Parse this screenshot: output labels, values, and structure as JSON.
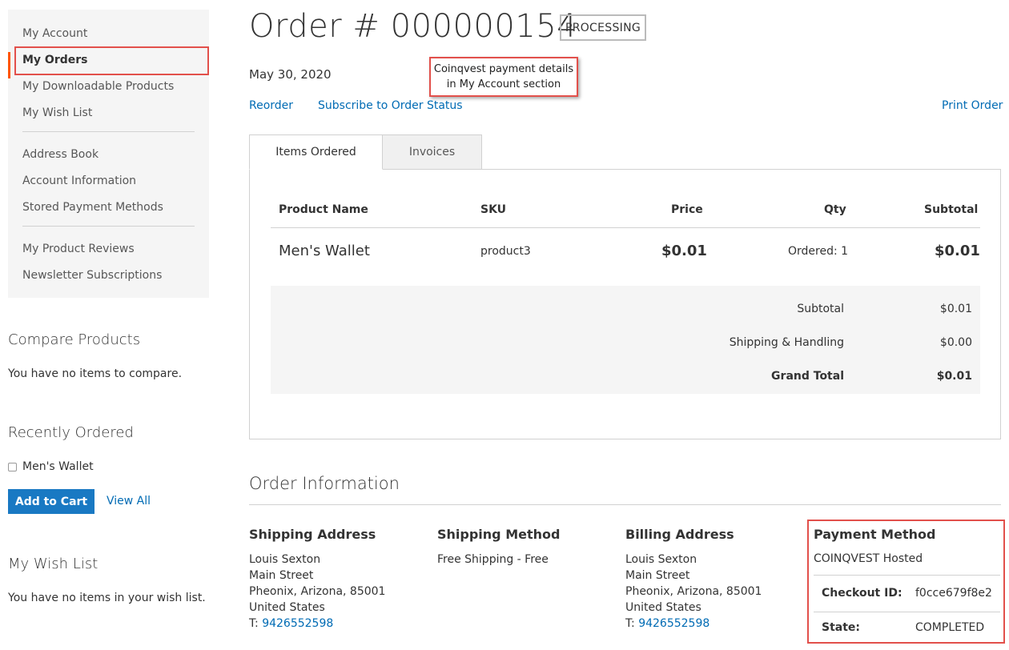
{
  "sidebar": {
    "items": [
      {
        "label": "My Account"
      },
      {
        "label": "My Orders"
      },
      {
        "label": "My Downloadable Products"
      },
      {
        "label": "My Wish List"
      },
      {
        "label": "Address Book"
      },
      {
        "label": "Account Information"
      },
      {
        "label": "Stored Payment Methods"
      },
      {
        "label": "My Product Reviews"
      },
      {
        "label": "Newsletter Subscriptions"
      }
    ]
  },
  "compare": {
    "title": "Compare Products",
    "empty": "You have no items to compare."
  },
  "recent": {
    "title": "Recently Ordered",
    "item": "Men's Wallet",
    "add_to_cart": "Add to Cart",
    "view_all": "View All"
  },
  "wishlist": {
    "title": "My Wish List",
    "empty": "You have no items in your wish list."
  },
  "order": {
    "title": "Order # 000000154",
    "status": "PROCESSING",
    "date": "May 30, 2020",
    "callout": "Coinqvest payment details in My Account section",
    "reorder": "Reorder",
    "subscribe": "Subscribe to Order Status",
    "print": "Print Order"
  },
  "tabs": {
    "items_ordered": "Items Ordered",
    "invoices": "Invoices"
  },
  "table": {
    "headers": {
      "name": "Product Name",
      "sku": "SKU",
      "price": "Price",
      "qty": "Qty",
      "subtotal": "Subtotal"
    },
    "rows": [
      {
        "name": "Men's Wallet",
        "sku": "product3",
        "price": "$0.01",
        "qty": "Ordered: 1",
        "subtotal": "$0.01"
      }
    ],
    "totals": [
      {
        "label": "Subtotal",
        "value": "$0.01"
      },
      {
        "label": "Shipping & Handling",
        "value": "$0.00"
      },
      {
        "label": "Grand Total",
        "value": "$0.01"
      }
    ]
  },
  "info": {
    "title": "Order Information",
    "shipping_address": {
      "title": "Shipping Address",
      "name": "Louis Sexton",
      "street": "Main Street",
      "city": "Pheonix, Arizona, 85001",
      "country": "United States",
      "phone_prefix": "T: ",
      "phone": "9426552598"
    },
    "shipping_method": {
      "title": "Shipping Method",
      "value": "Free Shipping - Free"
    },
    "billing_address": {
      "title": "Billing Address",
      "name": "Louis Sexton",
      "street": "Main Street",
      "city": "Pheonix, Arizona, 85001",
      "country": "United States",
      "phone_prefix": "T: ",
      "phone": "9426552598"
    },
    "payment": {
      "title": "Payment Method",
      "method": "COINQVEST Hosted",
      "checkout_label": "Checkout ID:",
      "checkout_value": "f0cce679f8e2",
      "state_label": "State:",
      "state_value": "COMPLETED"
    }
  },
  "colors": {
    "accent": "#ff5501",
    "link": "#006bb4",
    "button": "#1979c3",
    "highlight": "#e2504b"
  }
}
